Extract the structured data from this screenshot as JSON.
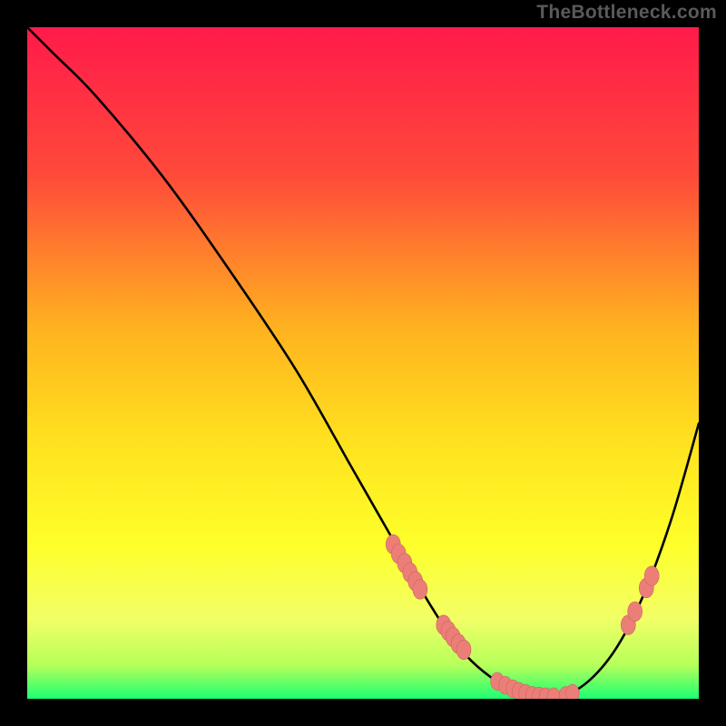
{
  "attribution": "TheBottleneck.com",
  "colors": {
    "background": "#000000",
    "attribution_text": "#5a5a5a",
    "curve": "#000000",
    "marker_fill": "#eb7f78",
    "marker_stroke": "#c9645e",
    "gradient_top": "#ff1a4a",
    "gradient_mid_upper": "#ff8a1f",
    "gradient_mid": "#ffd21f",
    "gradient_mid_lower": "#fff31f",
    "gradient_low": "#f7ff6a",
    "gradient_bottom": "#1cff73"
  },
  "chart_data": {
    "type": "line",
    "title": "",
    "xlabel": "",
    "ylabel": "",
    "xlim": [
      0,
      100
    ],
    "ylim": [
      0,
      100
    ],
    "series": [
      {
        "name": "bottleneck-curve",
        "x": [
          0,
          4,
          10,
          20,
          30,
          40,
          48,
          52,
          56,
          60,
          64,
          68,
          72,
          76,
          80,
          84,
          88,
          92,
          96,
          100
        ],
        "y": [
          100,
          96,
          90,
          78,
          64,
          49,
          35,
          28,
          21,
          14,
          8,
          4,
          1.5,
          0.3,
          0.5,
          3,
          8,
          16,
          27,
          41
        ]
      }
    ],
    "markers": [
      {
        "name": "cluster-left-descent",
        "points": [
          {
            "x": 54.5,
            "y": 23,
            "r": 1.2
          },
          {
            "x": 55.3,
            "y": 21.6,
            "r": 1.2
          },
          {
            "x": 56.2,
            "y": 20.2,
            "r": 1.2
          },
          {
            "x": 57.0,
            "y": 18.8,
            "r": 1.2
          },
          {
            "x": 57.8,
            "y": 17.5,
            "r": 1.2
          },
          {
            "x": 58.5,
            "y": 16.3,
            "r": 1.2
          }
        ]
      },
      {
        "name": "cluster-mid-descent",
        "points": [
          {
            "x": 62.0,
            "y": 11.0,
            "r": 1.2
          },
          {
            "x": 62.7,
            "y": 10.1,
            "r": 1.2
          },
          {
            "x": 63.4,
            "y": 9.2,
            "r": 1.2
          },
          {
            "x": 64.2,
            "y": 8.2,
            "r": 1.2
          },
          {
            "x": 65.0,
            "y": 7.3,
            "r": 1.2
          }
        ]
      },
      {
        "name": "bottom-cluster",
        "points": [
          {
            "x": 70.0,
            "y": 2.6,
            "r": 1.1
          },
          {
            "x": 71.2,
            "y": 2.0,
            "r": 1.1
          },
          {
            "x": 72.3,
            "y": 1.5,
            "r": 1.1
          },
          {
            "x": 73.2,
            "y": 1.1,
            "r": 1.1
          },
          {
            "x": 74.2,
            "y": 0.8,
            "r": 1.1
          },
          {
            "x": 75.2,
            "y": 0.5,
            "r": 1.1
          },
          {
            "x": 76.2,
            "y": 0.4,
            "r": 1.1
          },
          {
            "x": 77.2,
            "y": 0.3,
            "r": 1.1
          },
          {
            "x": 78.4,
            "y": 0.3,
            "r": 1.1
          },
          {
            "x": 80.2,
            "y": 0.5,
            "r": 1.1
          },
          {
            "x": 81.2,
            "y": 0.8,
            "r": 1.1
          }
        ]
      },
      {
        "name": "cluster-right-ascent",
        "points": [
          {
            "x": 89.5,
            "y": 11.0,
            "r": 1.2
          },
          {
            "x": 90.5,
            "y": 13.0,
            "r": 1.2
          },
          {
            "x": 92.2,
            "y": 16.5,
            "r": 1.2
          },
          {
            "x": 93.0,
            "y": 18.3,
            "r": 1.2
          }
        ]
      }
    ],
    "gradient_stops": [
      {
        "offset": 0.0,
        "color": "#ff1a4a"
      },
      {
        "offset": 0.22,
        "color": "#ff4a3a"
      },
      {
        "offset": 0.45,
        "color": "#ffb31f"
      },
      {
        "offset": 0.62,
        "color": "#ffe21f"
      },
      {
        "offset": 0.77,
        "color": "#feff2a"
      },
      {
        "offset": 0.88,
        "color": "#f2ff66"
      },
      {
        "offset": 0.95,
        "color": "#b6ff5a"
      },
      {
        "offset": 1.0,
        "color": "#1cff73"
      }
    ]
  }
}
